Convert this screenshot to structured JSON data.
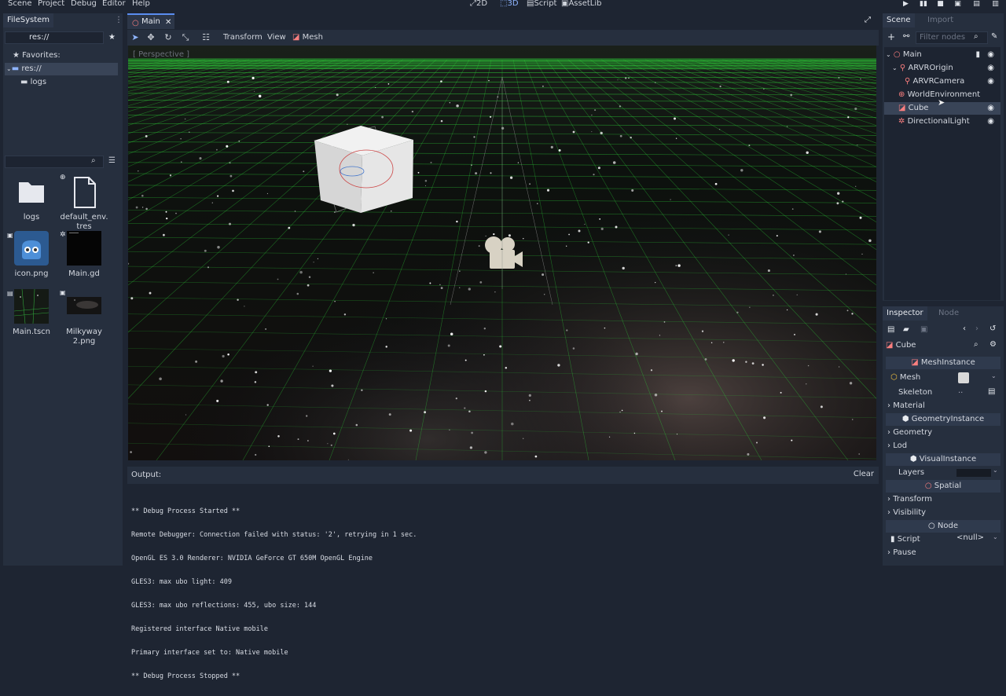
{
  "menubar": {
    "items": [
      "Scene",
      "Project",
      "Debug",
      "Editor",
      "Help"
    ],
    "modes": [
      "2D",
      "3D",
      "Script",
      "AssetLib"
    ],
    "active_mode": "3D"
  },
  "filesystem": {
    "tab": "FileSystem",
    "path": "res://",
    "tree": [
      "Favorites:",
      "res://",
      "logs"
    ],
    "files": [
      "logs",
      "default_env.tres",
      "icon.png",
      "Main.gd",
      "Main.tscn",
      "Milkyway 2.png"
    ]
  },
  "editor": {
    "tab": "Main",
    "toolbar": {
      "transform": "Transform",
      "view": "View",
      "mesh": "Mesh"
    },
    "viewport_label": "[ Perspective ]"
  },
  "output": {
    "title": "Output:",
    "clear": "Clear",
    "log": [
      "** Debug Process Started **",
      "Remote Debugger: Connection failed with status: '2', retrying in 1 sec.",
      "OpenGL ES 3.0 Renderer: NVIDIA GeForce GT 650M OpenGL Engine",
      "GLES3: max ubo light: 409",
      "GLES3: max ubo reflections: 455, ubo size: 144",
      "Registered interface Native mobile",
      "Primary interface set to: Native mobile",
      "** Debug Process Stopped **"
    ]
  },
  "scene": {
    "tabs": [
      "Scene",
      "Import"
    ],
    "filter_placeholder": "Filter nodes",
    "nodes": [
      "Main",
      "ARVROrigin",
      "ARVRCamera",
      "WorldEnvironment",
      "Cube",
      "DirectionalLight"
    ],
    "selected": "Cube"
  },
  "inspector": {
    "tabs": [
      "Inspector",
      "Node"
    ],
    "object": "Cube",
    "sections": {
      "mesh_instance": "MeshInstance",
      "geometry_instance": "GeometryInstance",
      "visual_instance": "VisualInstance",
      "spatial": "Spatial",
      "node": "Node"
    },
    "props": {
      "mesh": "Mesh",
      "skeleton": "Skeleton",
      "skeleton_value": "..",
      "layers": "Layers",
      "script": "Script",
      "script_value": "<null>"
    },
    "categories": {
      "material": "Material",
      "geometry": "Geometry",
      "lod": "Lod",
      "transform": "Transform",
      "visibility": "Visibility",
      "pause": "Pause"
    }
  },
  "colors": {
    "accent": "#5a8df0",
    "grid": "#2fd33a",
    "node_red": "#fc7f7f"
  }
}
